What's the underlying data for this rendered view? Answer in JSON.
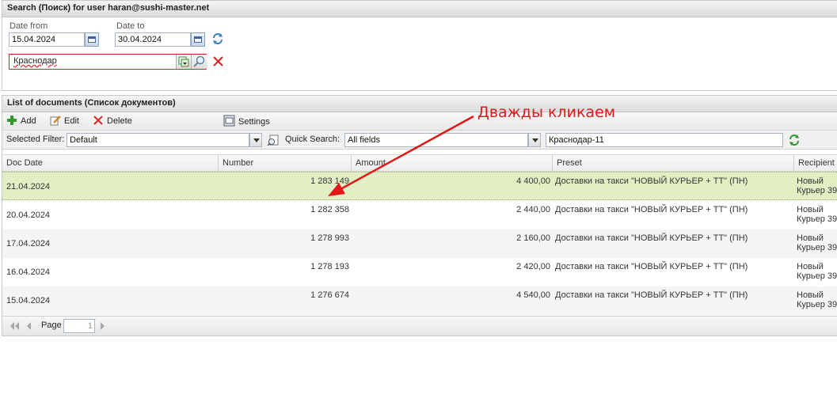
{
  "search": {
    "title": "Search (Поиск) for user haran@sushi-master.net",
    "date_from_label": "Date from",
    "date_from_value": "15.04.2024",
    "date_to_label": "Date to",
    "date_to_value": "30.04.2024",
    "city_value": "Краснодар"
  },
  "documents": {
    "title": "List of documents (Список документов)",
    "toolbar": {
      "add": "Add",
      "edit": "Edit",
      "delete": "Delete",
      "settings": "Settings"
    },
    "filter": {
      "selected_filter_label": "Selected Filter:",
      "selected_filter_value": "Default",
      "quick_search_label": "Quick Search:",
      "quick_search_field": "All fields",
      "quick_search_value": "Краснодар-11"
    },
    "columns": [
      "Doc Date",
      "Number",
      "Amount",
      "Preset",
      "Recipient"
    ],
    "rows": [
      {
        "date": "21.04.2024",
        "number": "1 283 149",
        "amount": "4 400,00",
        "preset": "Доставки на такси \"НОВЫЙ КУРЬЕР + ТТ\" (ПН)",
        "recipient": "Новый Курьер 39"
      },
      {
        "date": "20.04.2024",
        "number": "1 282 358",
        "amount": "2 440,00",
        "preset": "Доставки на такси \"НОВЫЙ КУРЬЕР + ТТ\" (ПН)",
        "recipient": "Новый Курьер 39"
      },
      {
        "date": "17.04.2024",
        "number": "1 278 993",
        "amount": "2 160,00",
        "preset": "Доставки на такси \"НОВЫЙ КУРЬЕР + ТТ\" (ПН)",
        "recipient": "Новый Курьер 39"
      },
      {
        "date": "16.04.2024",
        "number": "1 278 193",
        "amount": "2 420,00",
        "preset": "Доставки на такси \"НОВЫЙ КУРЬЕР + ТТ\" (ПН)",
        "recipient": "Новый Курьер 39"
      },
      {
        "date": "15.04.2024",
        "number": "1 276 674",
        "amount": "4 540,00",
        "preset": "Доставки на такси \"НОВЫЙ КУРЬЕР + ТТ\" (ПН)",
        "recipient": "Новый Курьер 39"
      }
    ],
    "pager": {
      "page_label": "Page",
      "page_value": "1"
    }
  },
  "annotation": {
    "text": "Дважды кликаем",
    "color": "#e01818"
  },
  "colors": {
    "selected_row": "#e2efc4",
    "error_red": "#e02020",
    "accent_blue": "#3a62a8"
  }
}
